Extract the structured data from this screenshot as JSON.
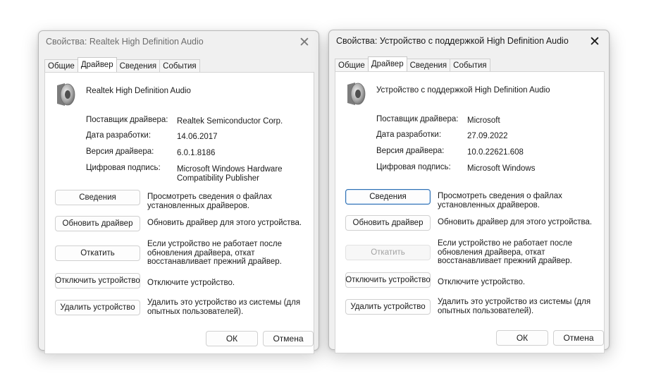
{
  "dialogs": [
    {
      "title": "Свойства: Realtek High Definition Audio",
      "tabs": [
        "Общие",
        "Драйвер",
        "Сведения",
        "События"
      ],
      "device_name": "Realtek High Definition Audio",
      "props": {
        "provider_label": "Поставщик драйвера:",
        "provider": "Realtek Semiconductor Corp.",
        "date_label": "Дата разработки:",
        "date": "14.06.2017",
        "version_label": "Версия драйвера:",
        "version": "6.0.1.8186",
        "signer_label": "Цифровая подпись:",
        "signer_line1": "Microsoft Windows Hardware",
        "signer_line2": "Compatibility Publisher"
      },
      "buttons": {
        "details": "Сведения",
        "details_desc1": "Просмотреть сведения о файлах",
        "details_desc2": "установленных драйверов.",
        "update": "Обновить драйвер",
        "update_desc": "Обновить драйвер для этого устройства.",
        "rollback": "Откатить",
        "rollback_desc1": "Если устройство не работает после",
        "rollback_desc2": "обновления драйвера, откат",
        "rollback_desc3": "восстанавливает прежний драйвер.",
        "disable": "Отключить устройство",
        "disable_desc": "Отключите устройство.",
        "uninstall": "Удалить устройство",
        "uninstall_desc1": "Удалить это устройство из системы (для",
        "uninstall_desc2": "опытных пользователей)."
      },
      "ok": "ОК",
      "cancel": "Отмена"
    },
    {
      "title": "Свойства: Устройство с поддержкой High Definition Audio",
      "tabs": [
        "Общие",
        "Драйвер",
        "Сведения",
        "События"
      ],
      "device_name": "Устройство с поддержкой High Definition Audio",
      "props": {
        "provider_label": "Поставщик драйвера:",
        "provider": "Microsoft",
        "date_label": "Дата разработки:",
        "date": "27.09.2022",
        "version_label": "Версия драйвера:",
        "version": "10.0.22621.608",
        "signer_label": "Цифровая подпись:",
        "signer_line1": "Microsoft Windows"
      },
      "buttons": {
        "details": "Сведения",
        "details_desc1": "Просмотреть сведения о файлах",
        "details_desc2": "установленных драйверов.",
        "update": "Обновить драйвер",
        "update_desc": "Обновить драйвер для этого устройства.",
        "rollback": "Откатить",
        "rollback_desc1": "Если устройство не работает после",
        "rollback_desc2": "обновления драйвера, откат",
        "rollback_desc3": "восстанавливает прежний драйвер.",
        "disable": "Отключить устройство",
        "disable_desc": "Отключите устройство.",
        "uninstall": "Удалить устройство",
        "uninstall_desc1": "Удалить это устройство из системы (для",
        "uninstall_desc2": "опытных пользователей)."
      },
      "ok": "ОК",
      "cancel": "Отмена"
    }
  ],
  "icons": {
    "close": "close-icon",
    "device": "speaker-icon"
  }
}
